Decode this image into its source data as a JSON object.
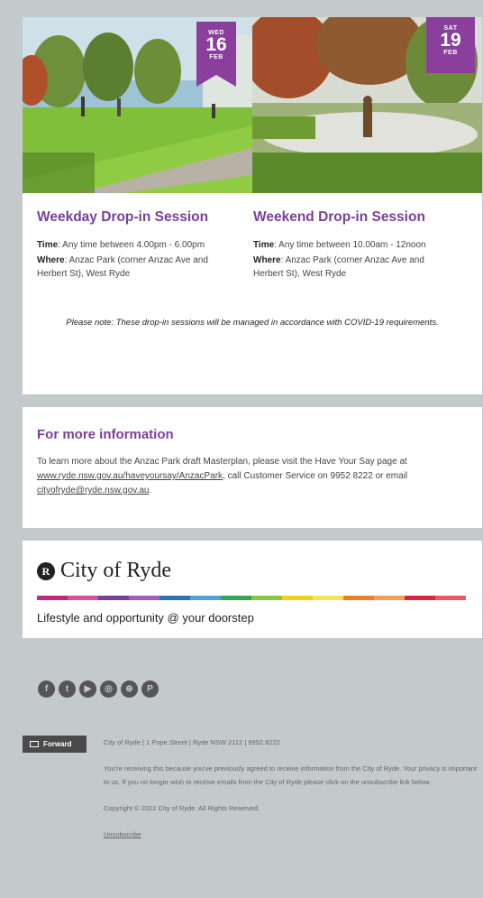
{
  "sessions": [
    {
      "badge": {
        "weekday": "WED",
        "day": "16",
        "month": "FEB"
      },
      "title": "Weekday Drop-in Session",
      "time_label": "Time",
      "time_value": ":  Any time between 4.00pm - 6.00pm",
      "where_label": "Where",
      "where_value": ": Anzac Park (corner Anzac Ave and Herbert St), West Ryde"
    },
    {
      "badge": {
        "weekday": "SAT",
        "day": "19",
        "month": "FEB"
      },
      "title": "Weekend Drop-in Session",
      "time_label": "Time",
      "time_value": ":  Any time between 10.00am - 12noon",
      "where_label": "Where",
      "where_value": ": Anzac Park (corner Anzac Ave and Herbert St), West Ryde"
    }
  ],
  "note": "Please note: These drop-in sessions will be managed in accordance with COVID-19 requirements.",
  "info": {
    "title": "For more information",
    "text_1": "To learn more about the Anzac Park draft Masterplan, please visit the Have Your Say page at ",
    "link_1": "www.ryde.nsw.gov.au/haveyoursay/AnzacPark",
    "text_2": ", call Customer Service on 9952 8222 or email ",
    "link_2": "cityofryde@ryde.nsw.gov.au",
    "text_3": "."
  },
  "brand": {
    "logo_letter": "R",
    "logo_text": "City of Ryde",
    "tagline": "Lifestyle and opportunity @ your doorstep",
    "colors": [
      "#c4267f",
      "#d94f96",
      "#7b3f9a",
      "#a35fb5",
      "#2b73b8",
      "#4ea3d8",
      "#2fa84f",
      "#8cc63e",
      "#f2d21b",
      "#f4e35b",
      "#ef7d22",
      "#f2a052",
      "#d7263d",
      "#e85a5a"
    ]
  },
  "social": [
    {
      "icon": "facebook-icon",
      "glyph": "f"
    },
    {
      "icon": "twitter-icon",
      "glyph": "t"
    },
    {
      "icon": "youtube-icon",
      "glyph": "▶"
    },
    {
      "icon": "instagram-icon",
      "glyph": "◎"
    },
    {
      "icon": "website-icon",
      "glyph": "⊕"
    },
    {
      "icon": "pinterest-icon",
      "glyph": "P"
    }
  ],
  "footer": {
    "forward_label": "Forward",
    "address": "City of Ryde | 1 Pope Street | Ryde NSW 2112 | 9952 8222",
    "reason": "You're receiving this because you've previously agreed to receive information from the City of Ryde. Your privacy is important to us. If you no longer wish to receive emails from the City of Ryde please click on the unsubscribe link below.",
    "copyright": "Copyright © 2022 City of Ryde. All Rights Reserved.",
    "unsubscribe": "Unsubscribe"
  }
}
